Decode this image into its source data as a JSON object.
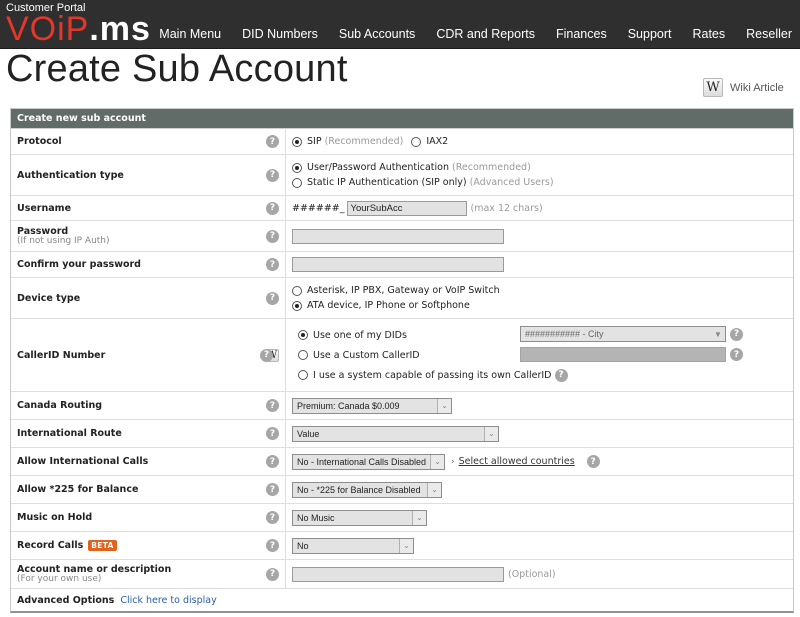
{
  "header": {
    "portal_label": "Customer Portal",
    "logo_red": "VOiP",
    "logo_white": ".ms",
    "nav": [
      {
        "label": "Main Menu"
      },
      {
        "label": "DID Numbers"
      },
      {
        "label": "Sub Accounts"
      },
      {
        "label": "CDR and Reports"
      },
      {
        "label": "Finances"
      },
      {
        "label": "Support"
      },
      {
        "label": "Rates"
      },
      {
        "label": "Reseller"
      }
    ]
  },
  "page": {
    "title": "Create Sub Account",
    "wiki_icon": "W",
    "wiki_label": "Wiki Article"
  },
  "form": {
    "header": "Create new sub account",
    "help_glyph": "?",
    "protocol": {
      "label": "Protocol",
      "options": [
        {
          "label": "SIP",
          "note": "(Recommended)",
          "selected": true
        },
        {
          "label": "IAX2",
          "note": "",
          "selected": false
        }
      ]
    },
    "auth_type": {
      "label": "Authentication type",
      "options": [
        {
          "label": "User/Password Authentication",
          "note": "(Recommended)",
          "selected": true
        },
        {
          "label": "Static IP Authentication (SIP only)",
          "note": "(Advanced Users)",
          "selected": false
        }
      ]
    },
    "username": {
      "label": "Username",
      "prefix": "######_",
      "value": "YourSubAcc",
      "hint": "(max 12 chars)"
    },
    "password": {
      "label": "Password",
      "sublabel": "(If not using IP Auth)",
      "value": ""
    },
    "confirm_password": {
      "label": "Confirm your password",
      "value": ""
    },
    "device_type": {
      "label": "Device type",
      "options": [
        {
          "label": "Asterisk, IP PBX, Gateway or VoIP Switch",
          "selected": false
        },
        {
          "label": "ATA device, IP Phone or Softphone",
          "selected": true
        }
      ]
    },
    "callerid": {
      "label": "CallerID Number",
      "wiki_icon": "W",
      "options": [
        {
          "label": "Use one of my DIDs",
          "selected": true
        },
        {
          "label": "Use a Custom CallerID",
          "selected": false
        },
        {
          "label": "I use a system capable of passing its own CallerID",
          "selected": false
        }
      ],
      "did_select": "########### - City",
      "custom_value": ""
    },
    "canada_routing": {
      "label": "Canada Routing",
      "value": "Premium: Canada $0.009"
    },
    "intl_route": {
      "label": "International Route",
      "value": "Value"
    },
    "allow_intl": {
      "label": "Allow International Calls",
      "value": "No - International Calls Disabled",
      "link": "Select allowed countries",
      "link_prefix": "›"
    },
    "allow_225": {
      "label": "Allow *225 for Balance",
      "value": "No - *225 for Balance Disabled"
    },
    "music_on_hold": {
      "label": "Music on Hold",
      "value": "No Music"
    },
    "record_calls": {
      "label": "Record Calls",
      "badge": "BETA",
      "value": "No"
    },
    "account_desc": {
      "label": "Account name or description",
      "sublabel": "(For your own use)",
      "value": "",
      "hint": "(Optional)"
    },
    "advanced": {
      "label": "Advanced Options",
      "link": "Click here to display"
    },
    "select_arrow": "⌄"
  }
}
